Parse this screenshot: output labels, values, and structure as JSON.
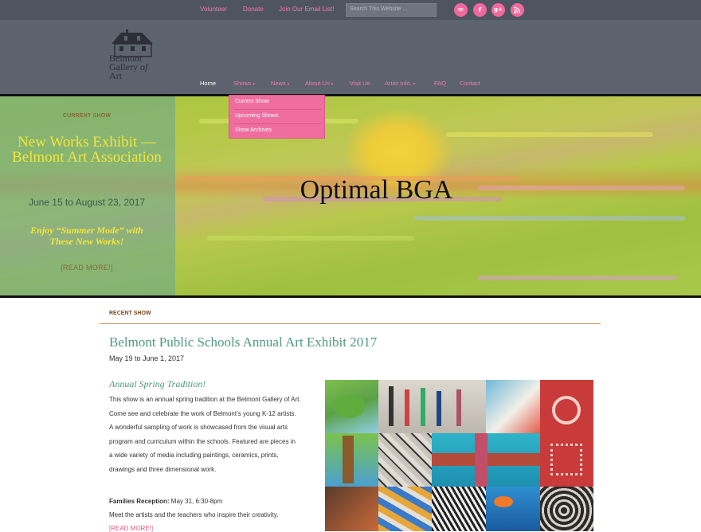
{
  "top_links": [
    "Volunteer",
    "Donate",
    "Join Our Email List!"
  ],
  "search": {
    "placeholder": "Search This Website ..."
  },
  "social_icons": [
    "email-icon",
    "facebook-icon",
    "google-plus-icon",
    "rss-icon"
  ],
  "logo": {
    "line1": "Belmont",
    "line2": "Gallery",
    "line2b": "of",
    "line3": "Art"
  },
  "nav": [
    {
      "label": "Home",
      "active": true
    },
    {
      "label": "Shows",
      "dropdown": true
    },
    {
      "label": "News",
      "dropdown": true
    },
    {
      "label": "About Us",
      "dropdown": true
    },
    {
      "label": "Visit Us"
    },
    {
      "label": "Artist Info.",
      "dropdown": true
    },
    {
      "label": "FAQ"
    },
    {
      "label": "Contact"
    }
  ],
  "dropdown": [
    "Current Show",
    "Upcoming Shows",
    "Show Archives"
  ],
  "hero": {
    "kicker": "CURRENT SHOW",
    "title": "New Works Exhibit — Belmont Art Association",
    "dates": "June 15 to August 23, 2017",
    "tagline": "Enjoy “Summer Mode” with These New Works!",
    "read_more": "[READ MORE!]",
    "overlay_title": "Optimal BGA"
  },
  "recent": {
    "kicker": "RECENT SHOW",
    "title": "Belmont Public Schools Annual Art Exhibit 2017",
    "dates": "May 19 to June 1, 2017",
    "subtitle": "Annual Spring Tradition!",
    "body_lines": [
      "This show is an annual spring tradition at the Belmont Gallery of Art.",
      "Come see and celebrate the work of Belmont’s young K-12 artists.",
      "A wonderful sampling of work is showcased from the visual arts",
      "program and curriculum within the schools. Featured are pieces in",
      "a wide variety of media including paintings, ceramics, prints,",
      "drawings and three dimensional work."
    ],
    "reception_label": "Families Reception:",
    "reception_value": " May 31, 6:30-8pm",
    "reception_note": "Meet the artists and the teachers who inspire their creativity.",
    "read_more": "[READ MORE!]"
  },
  "colors": {
    "accent_pink": "#f27aa6",
    "header_gray": "#5d636e",
    "topbar_gray": "#4f5560",
    "teal_heading": "#4f9880",
    "hero_yellow": "#f4e53a"
  }
}
